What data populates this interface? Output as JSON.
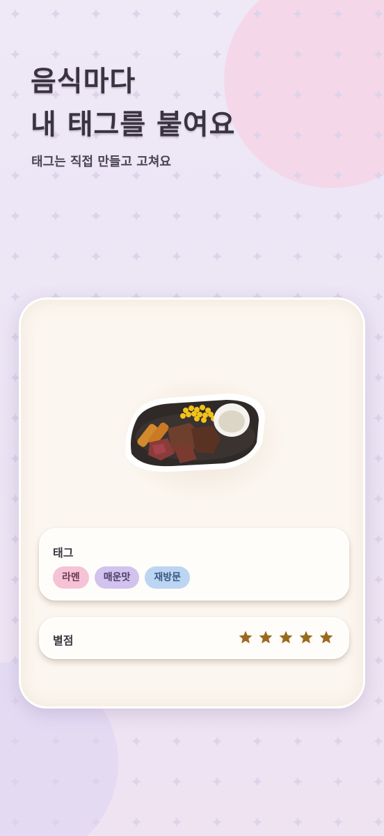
{
  "header": {
    "title_line1": "음식마다",
    "title_line2": "내 태그를 붙여요",
    "subtitle": "태그는 직접 만들고 고쳐요"
  },
  "card": {
    "food_image_icon": "steak-platter-image",
    "tag_section": {
      "label": "태그",
      "tags": [
        {
          "label": "라멘",
          "color": "#f6c2d6"
        },
        {
          "label": "매운맛",
          "color": "#d2c2ee"
        },
        {
          "label": "재방문",
          "color": "#bcd5f2"
        }
      ]
    },
    "rating_section": {
      "label": "별점",
      "rating": 5,
      "max_rating": 5,
      "star_color": "#9a6a1c"
    }
  },
  "colors": {
    "background": "#ece6f6",
    "pink_blob": "#f4d6e8",
    "card_background": "#fbf6ef"
  }
}
